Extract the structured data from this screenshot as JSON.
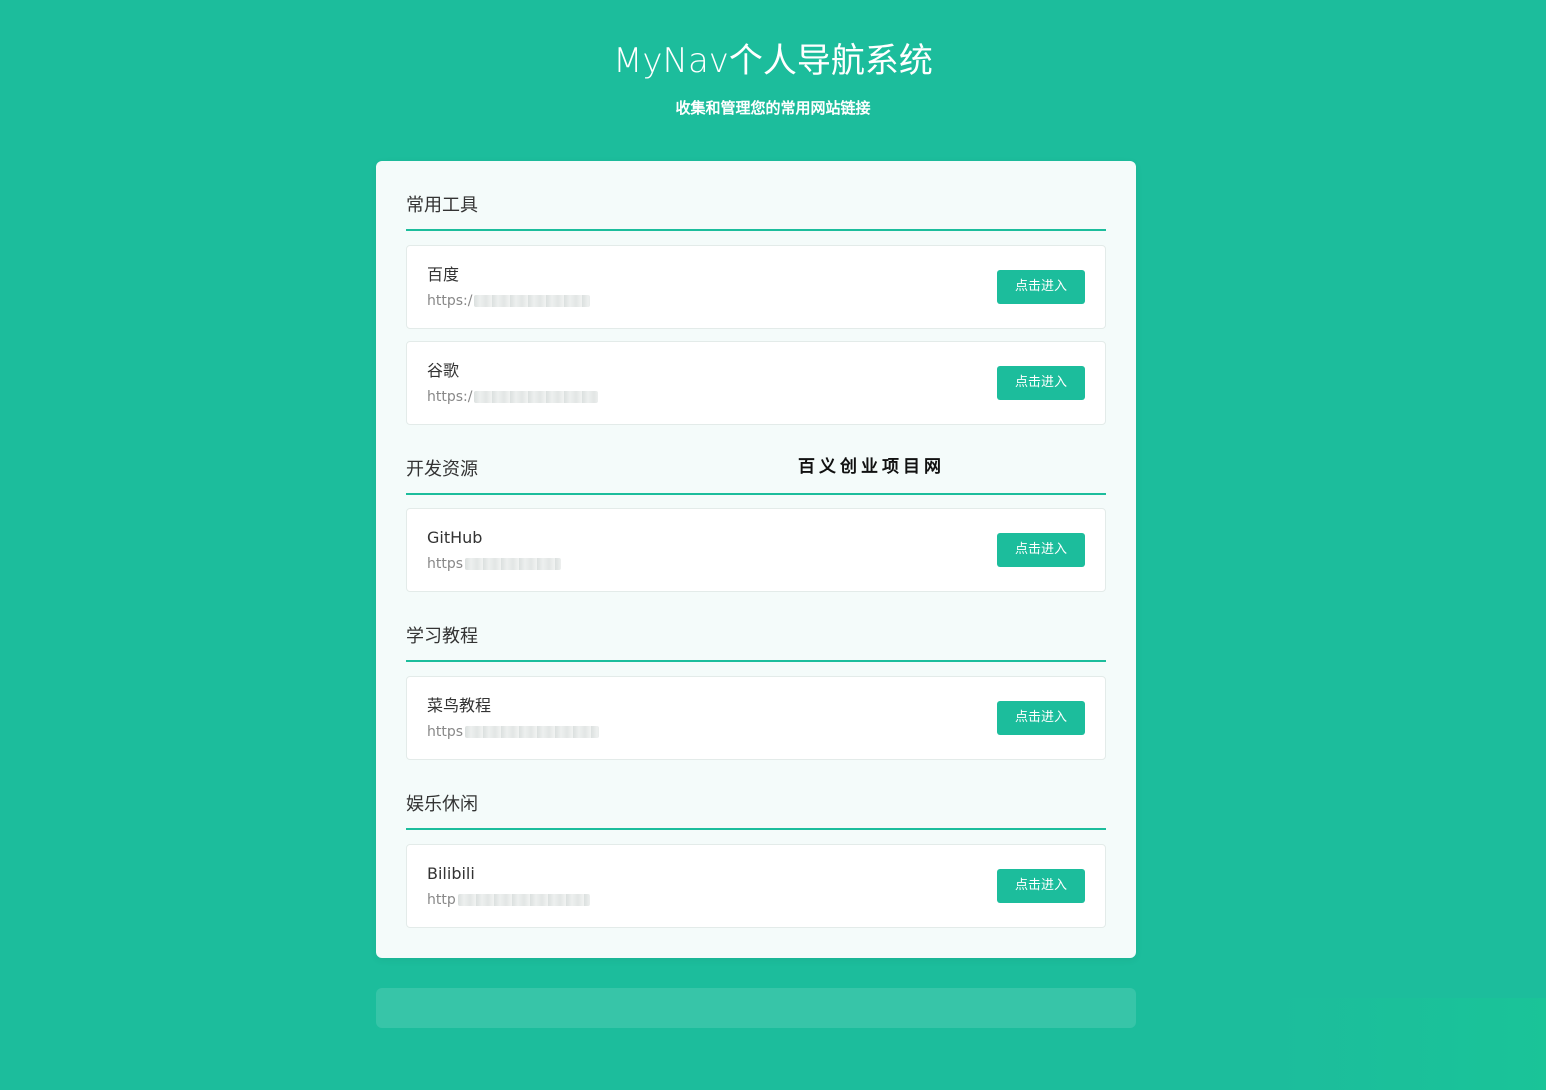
{
  "header": {
    "title": "MyNav个人导航系统",
    "subtitle": "收集和管理您的常用网站链接"
  },
  "watermark": "百义创业项目网",
  "sections": [
    {
      "title": "常用工具",
      "links": [
        {
          "name": "百度",
          "url_prefix": "https:/",
          "button_label": "点击进入"
        },
        {
          "name": "谷歌",
          "url_prefix": "https:/",
          "button_label": "点击进入"
        }
      ]
    },
    {
      "title": "开发资源",
      "links": [
        {
          "name": "GitHub",
          "url_prefix": "https",
          "button_label": "点击进入"
        }
      ]
    },
    {
      "title": "学习教程",
      "links": [
        {
          "name": "菜鸟教程",
          "url_prefix": "https",
          "button_label": "点击进入"
        }
      ]
    },
    {
      "title": "娱乐休闲",
      "links": [
        {
          "name": "Bilibili",
          "url_prefix": "http",
          "button_label": "点击进入"
        }
      ]
    }
  ],
  "colors": {
    "accent": "#1cbd9c",
    "panel": "#f4fbfa",
    "card": "#ffffff",
    "text": "#333333",
    "muted": "#888888"
  }
}
